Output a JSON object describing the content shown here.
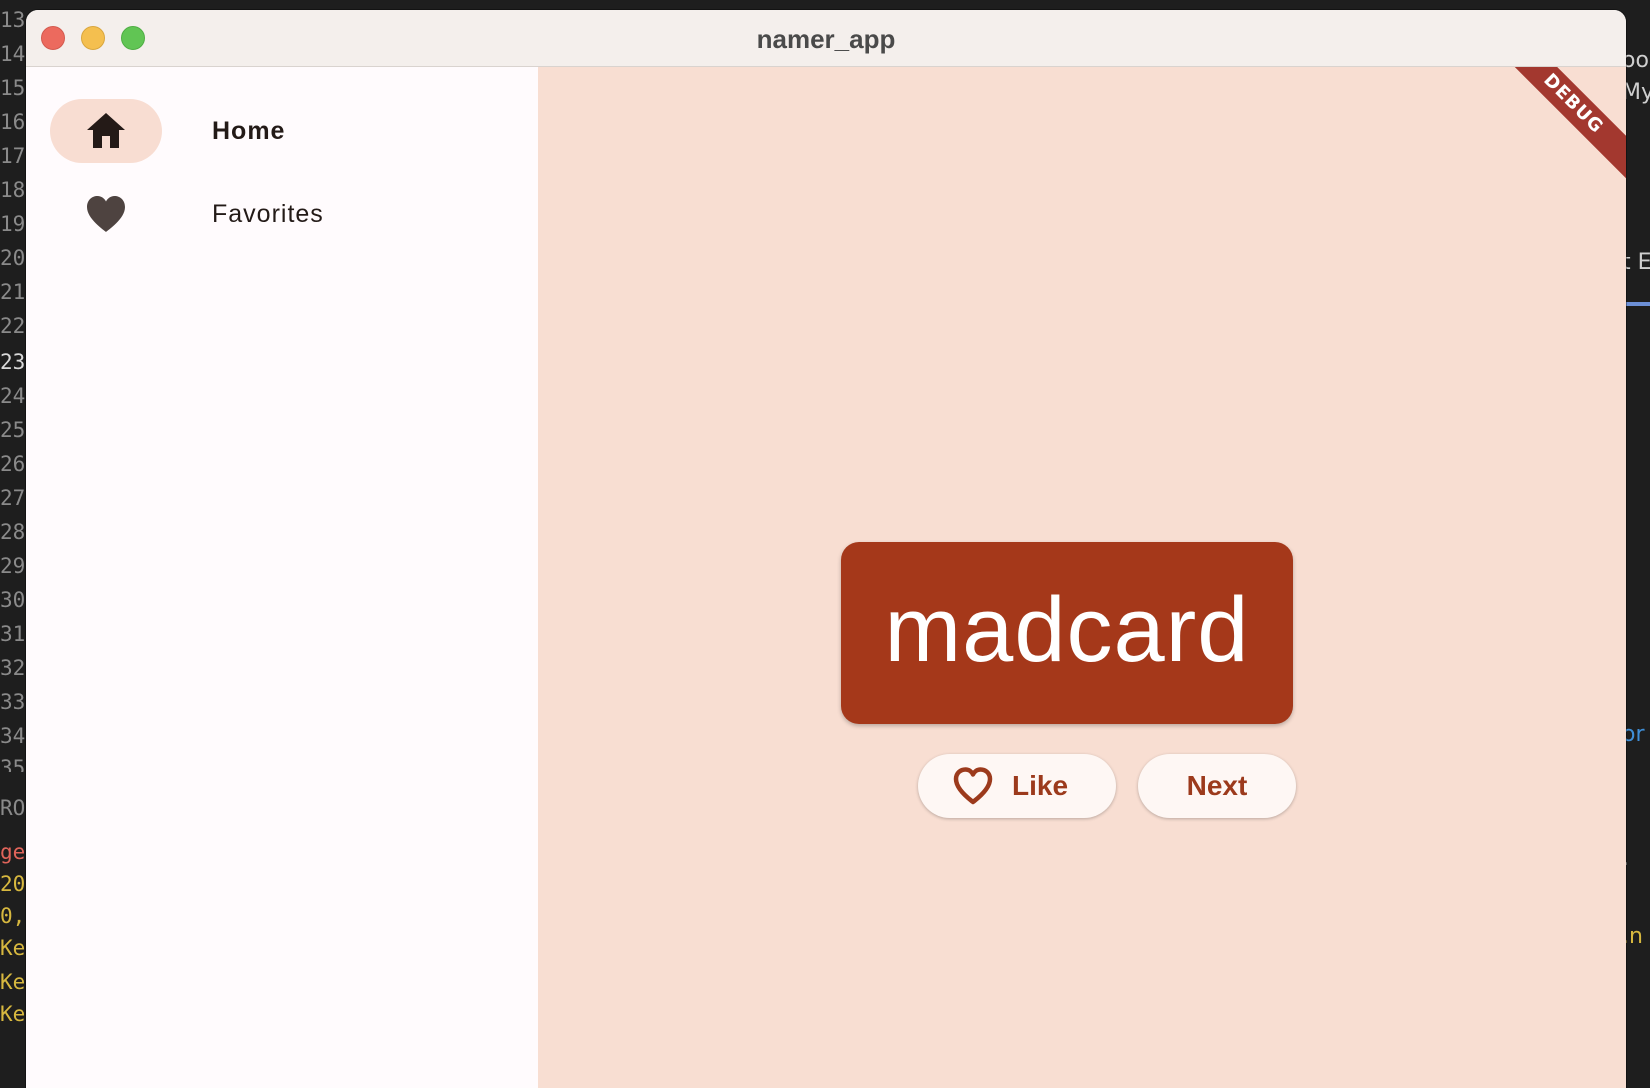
{
  "window": {
    "title": "namer_app"
  },
  "sidebar": {
    "items": [
      {
        "label": "Home",
        "icon": "home-icon",
        "selected": true
      },
      {
        "label": "Favorites",
        "icon": "heart-icon",
        "selected": false
      }
    ]
  },
  "main": {
    "debug_banner": "DEBUG",
    "word": "madcard",
    "like_button": {
      "label": "Like",
      "icon": "heart-outline-icon"
    },
    "next_button": {
      "label": "Next"
    }
  },
  "background": {
    "line_numbers": [
      "13",
      "14",
      "15",
      "16",
      "17",
      "18",
      "19",
      "20",
      "21",
      "22",
      "23",
      "24",
      "25",
      "26",
      "27",
      "28",
      "29",
      "30",
      "31",
      "32",
      "33",
      "34",
      "35"
    ],
    "panel_fragments": [
      "RO",
      "ge",
      "20",
      "0,",
      "Ke",
      "Ke",
      "Ke"
    ],
    "right_fragments": [
      "oo",
      "My",
      "t E",
      "or",
      ".",
      ".n"
    ]
  },
  "colors": {
    "accent": "#a5381a",
    "main_background": "#f8ded2",
    "nav_indicator": "#f8ddd2",
    "sidebar_background": "#fffbfd",
    "debug_ribbon": "#a3382f"
  }
}
